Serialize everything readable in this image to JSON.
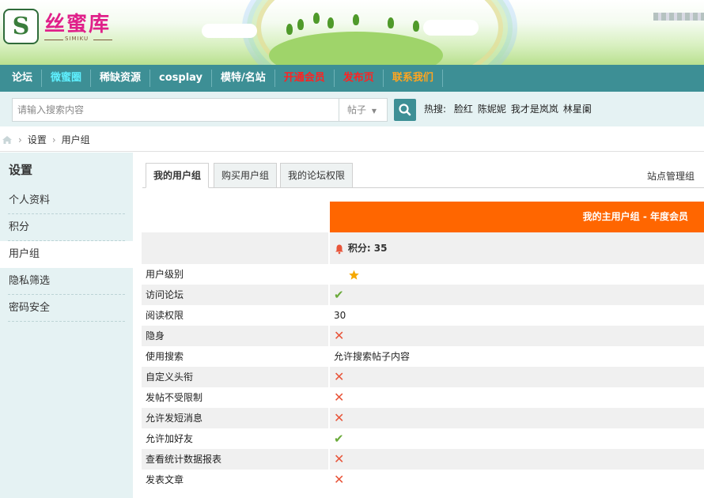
{
  "brand": {
    "name": "丝蜜库",
    "subtitle": "SIMIKU",
    "logo_letter": "S"
  },
  "nav": {
    "items": [
      {
        "label": "论坛",
        "color": "#ffffff"
      },
      {
        "label": "微蜜圈",
        "color": "#5ff0ff"
      },
      {
        "label": "稀缺资源",
        "color": "#ffffff"
      },
      {
        "label": "cosplay",
        "color": "#ffffff"
      },
      {
        "label": "模特/名站",
        "color": "#ffffff"
      },
      {
        "label": "开通会员",
        "color": "#ff2222"
      },
      {
        "label": "发布页",
        "color": "#ff2222"
      },
      {
        "label": "联系我们",
        "color": "#ffa520"
      }
    ]
  },
  "search": {
    "placeholder": "请输入搜索内容",
    "type_selected": "帖子",
    "hot_label": "热搜:",
    "hot_terms": [
      "脸红",
      "陈妮妮",
      "我才是岚岚",
      "林星阑"
    ]
  },
  "breadcrumb": {
    "items": [
      "设置",
      "用户组"
    ]
  },
  "sidebar": {
    "title": "设置",
    "items": [
      {
        "label": "个人资料",
        "active": false
      },
      {
        "label": "积分",
        "active": false
      },
      {
        "label": "用户组",
        "active": true
      },
      {
        "label": "隐私筛选",
        "active": false
      },
      {
        "label": "密码安全",
        "active": false
      }
    ]
  },
  "tabs": {
    "items": [
      {
        "label": "我的用户组",
        "active": true
      },
      {
        "label": "购买用户组",
        "active": false
      },
      {
        "label": "我的论坛权限",
        "active": false
      }
    ],
    "right_link": "站点管理组"
  },
  "group": {
    "header": "我的主用户组 - 年度会员",
    "score_label": "积分: 35",
    "rows": [
      {
        "label": "用户级别",
        "kind": "level"
      },
      {
        "label": "访问论坛",
        "kind": "ok"
      },
      {
        "label": "阅读权限",
        "kind": "text",
        "value": "30"
      },
      {
        "label": "隐身",
        "kind": "no"
      },
      {
        "label": "使用搜索",
        "kind": "text",
        "value": "允许搜索帖子内容"
      },
      {
        "label": "自定义头衔",
        "kind": "no"
      },
      {
        "label": "发帖不受限制",
        "kind": "no"
      },
      {
        "label": "允许发短消息",
        "kind": "no"
      },
      {
        "label": "允许加好友",
        "kind": "ok"
      },
      {
        "label": "查看统计数据报表",
        "kind": "no"
      },
      {
        "label": "发表文章",
        "kind": "no"
      }
    ]
  },
  "colors": {
    "teal": "#3d8f95",
    "orange": "#ff6600",
    "cross": "#e8553a",
    "check": "#6aaa3a"
  }
}
